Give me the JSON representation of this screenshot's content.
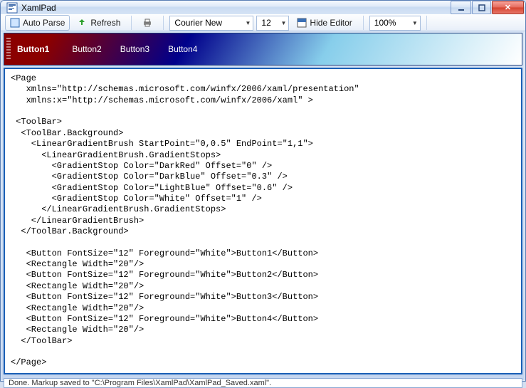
{
  "window": {
    "title": "XamlPad"
  },
  "toolbar": {
    "autoparse": "Auto Parse",
    "refresh": "Refresh",
    "font": "Courier New",
    "fontsize": "12",
    "hideeditor": "Hide Editor",
    "zoom": "100%"
  },
  "preview": {
    "buttons": [
      "Button1",
      "Button2",
      "Button3",
      "Button4"
    ]
  },
  "editor": {
    "code": "<Page\n   xmlns=\"http://schemas.microsoft.com/winfx/2006/xaml/presentation\"\n   xmlns:x=\"http://schemas.microsoft.com/winfx/2006/xaml\" >\n\n <ToolBar>\n  <ToolBar.Background>\n    <LinearGradientBrush StartPoint=\"0,0.5\" EndPoint=\"1,1\">\n      <LinearGradientBrush.GradientStops>\n        <GradientStop Color=\"DarkRed\" Offset=\"0\" />\n        <GradientStop Color=\"DarkBlue\" Offset=\"0.3\" />\n        <GradientStop Color=\"LightBlue\" Offset=\"0.6\" />\n        <GradientStop Color=\"White\" Offset=\"1\" />\n      </LinearGradientBrush.GradientStops>\n    </LinearGradientBrush>\n  </ToolBar.Background>\n\n   <Button FontSize=\"12\" Foreground=\"White\">Button1</Button>\n   <Rectangle Width=\"20\"/>\n   <Button FontSize=\"12\" Foreground=\"White\">Button2</Button>\n   <Rectangle Width=\"20\"/>\n   <Button FontSize=\"12\" Foreground=\"White\">Button3</Button>\n   <Rectangle Width=\"20\"/>\n   <Button FontSize=\"12\" Foreground=\"White\">Button4</Button>\n   <Rectangle Width=\"20\"/>\n  </ToolBar>\n\n</Page>"
  },
  "status": {
    "text": "Done. Markup saved to \"C:\\Program Files\\XamlPad\\XamlPad_Saved.xaml\"."
  }
}
